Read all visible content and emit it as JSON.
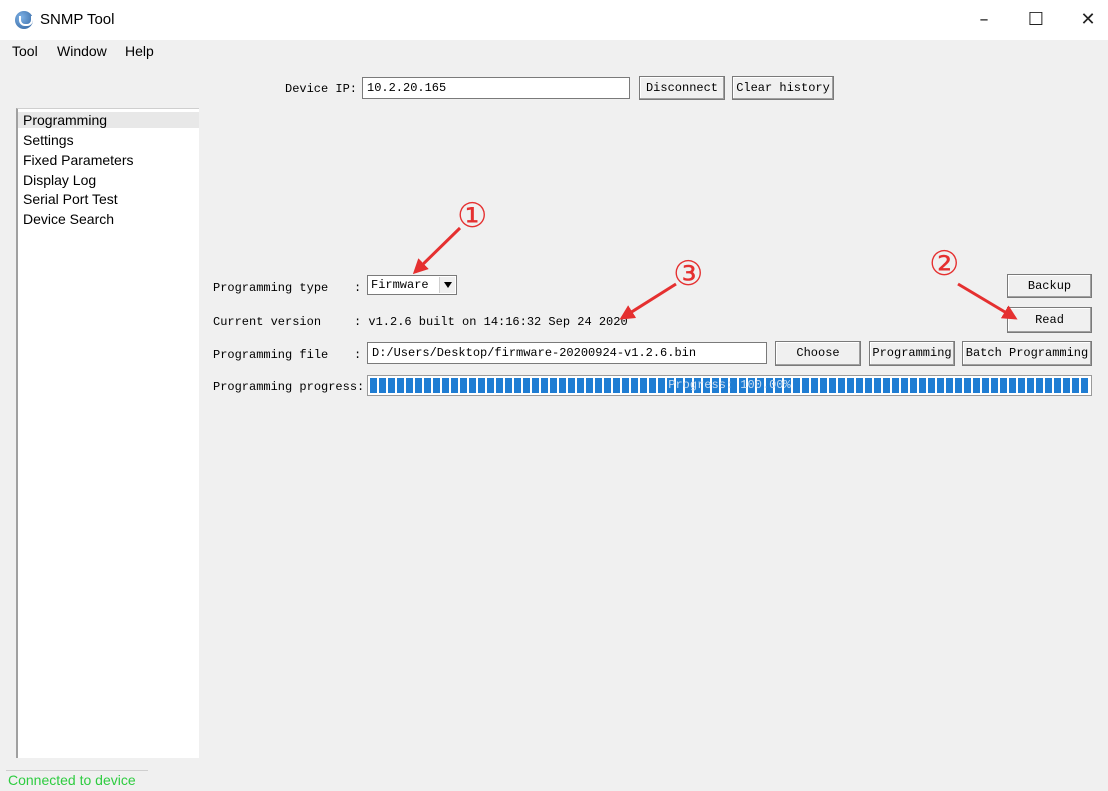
{
  "window": {
    "title": "SNMP Tool",
    "controls": {
      "minimize": "–",
      "maximize": "☐",
      "close": "✕"
    }
  },
  "menu": {
    "items": [
      {
        "label": "Tool"
      },
      {
        "label": "Window"
      },
      {
        "label": "Help"
      }
    ]
  },
  "sidebar": {
    "items": [
      {
        "label": "Programming",
        "selected": true
      },
      {
        "label": "Settings"
      },
      {
        "label": "Fixed Parameters"
      },
      {
        "label": "Display Log"
      },
      {
        "label": "Serial Port Test"
      },
      {
        "label": "Device Search"
      }
    ]
  },
  "top": {
    "device_ip_label": "Device IP:",
    "device_ip_value": "10.2.20.165",
    "disconnect_label": "Disconnect",
    "clear_history_label": "Clear history"
  },
  "programming": {
    "type_label": "Programming type",
    "type_value": "Firmware",
    "version_label": "Current version",
    "version_value": ": v1.2.6 built on 14:16:32 Sep 24 2020",
    "file_label": "Programming file",
    "file_value": "D:/Users/Desktop/firmware-20200924-v1.2.6.bin",
    "progress_label": "Programming progress:",
    "progress_text": "Progress: 100.00%",
    "progress_fraction": 1.0,
    "colon": ":",
    "buttons": {
      "backup": "Backup",
      "read": "Read",
      "choose": "Choose",
      "programming": "Programming",
      "batch_programming": "Batch Programming"
    }
  },
  "status": {
    "text": "Connected to device",
    "color": "#2ecc40"
  },
  "annotations": {
    "markers": [
      "①",
      "②",
      "③"
    ],
    "color": "#e53030"
  }
}
